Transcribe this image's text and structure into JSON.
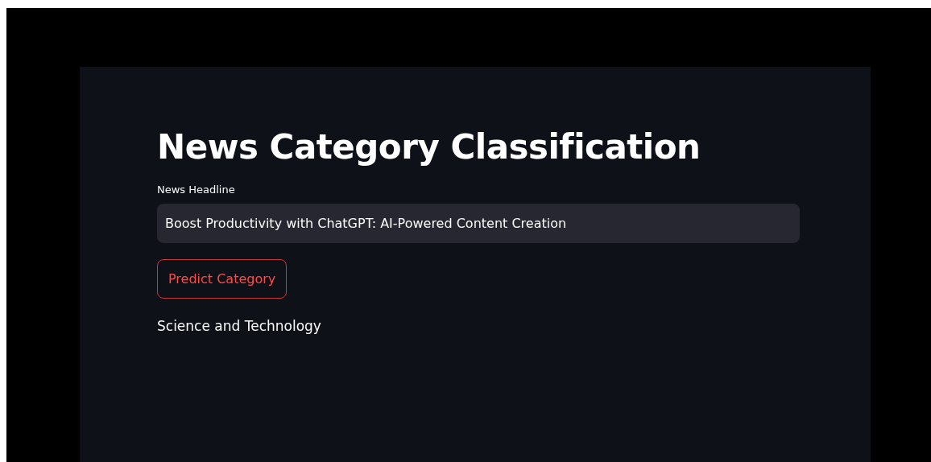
{
  "title": "News Category Classification",
  "headline_field": {
    "label": "News Headline",
    "value": "Boost Productivity with ChatGPT: AI-Powered Content Creation"
  },
  "predict_button": {
    "label": "Predict Category"
  },
  "result": "Science and Technology"
}
